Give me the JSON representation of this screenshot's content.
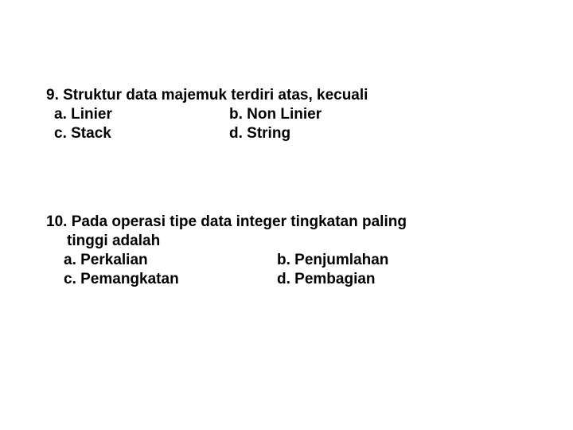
{
  "q9": {
    "number_text": "9. Struktur data majemuk terdiri atas, kecuali",
    "a": "a. Linier",
    "b": "b. Non Linier",
    "c": "c. Stack",
    "d": "d. String"
  },
  "q10": {
    "line1": "10. Pada operasi tipe data integer tingkatan paling",
    "line2": "tinggi adalah",
    "a": "a. Perkalian",
    "b": "b. Penjumlahan",
    "c": "c. Pemangkatan",
    "d": "d. Pembagian"
  }
}
